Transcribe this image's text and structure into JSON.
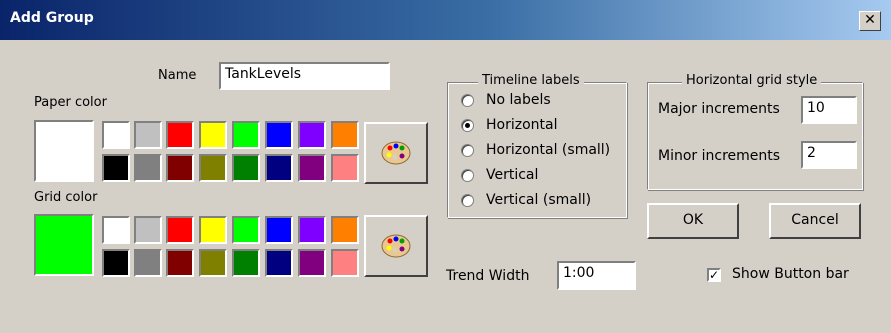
{
  "window": {
    "title": "Add Group",
    "close_glyph": "✕"
  },
  "name_label": "Name",
  "name_value": "TankLevels",
  "paper_color": {
    "label": "Paper color",
    "selected": "#ffffff",
    "top": [
      "#ffffff",
      "#c0c0c0",
      "#ff0000",
      "#ffff00",
      "#00ff00",
      "#0000ff",
      "#8000ff",
      "#ff8000"
    ],
    "bottom": [
      "#000000",
      "#808080",
      "#800000",
      "#808000",
      "#008000",
      "#000080",
      "#800080",
      "#ff8080"
    ]
  },
  "grid_color": {
    "label": "Grid color",
    "selected": "#00ff00",
    "top": [
      "#ffffff",
      "#c0c0c0",
      "#ff0000",
      "#ffff00",
      "#00ff00",
      "#0000ff",
      "#8000ff",
      "#ff8000"
    ],
    "bottom": [
      "#000000",
      "#808080",
      "#800000",
      "#808000",
      "#008000",
      "#000080",
      "#800080",
      "#ff8080"
    ]
  },
  "timeline": {
    "label": "Timeline labels",
    "options": [
      "No labels",
      "Horizontal",
      "Horizontal (small)",
      "Vertical",
      "Vertical (small)"
    ],
    "selected_index": 1
  },
  "grid_style": {
    "label": "Horizontal grid style",
    "major_label": "Major increments",
    "major_value": "10",
    "minor_label": "Minor increments",
    "minor_value": "2"
  },
  "ok_label": "OK",
  "cancel_label": "Cancel",
  "trend_width_label": "Trend Width",
  "trend_width_value": "1:00",
  "show_button_bar_label": "Show Button bar",
  "show_button_bar_checked": true
}
